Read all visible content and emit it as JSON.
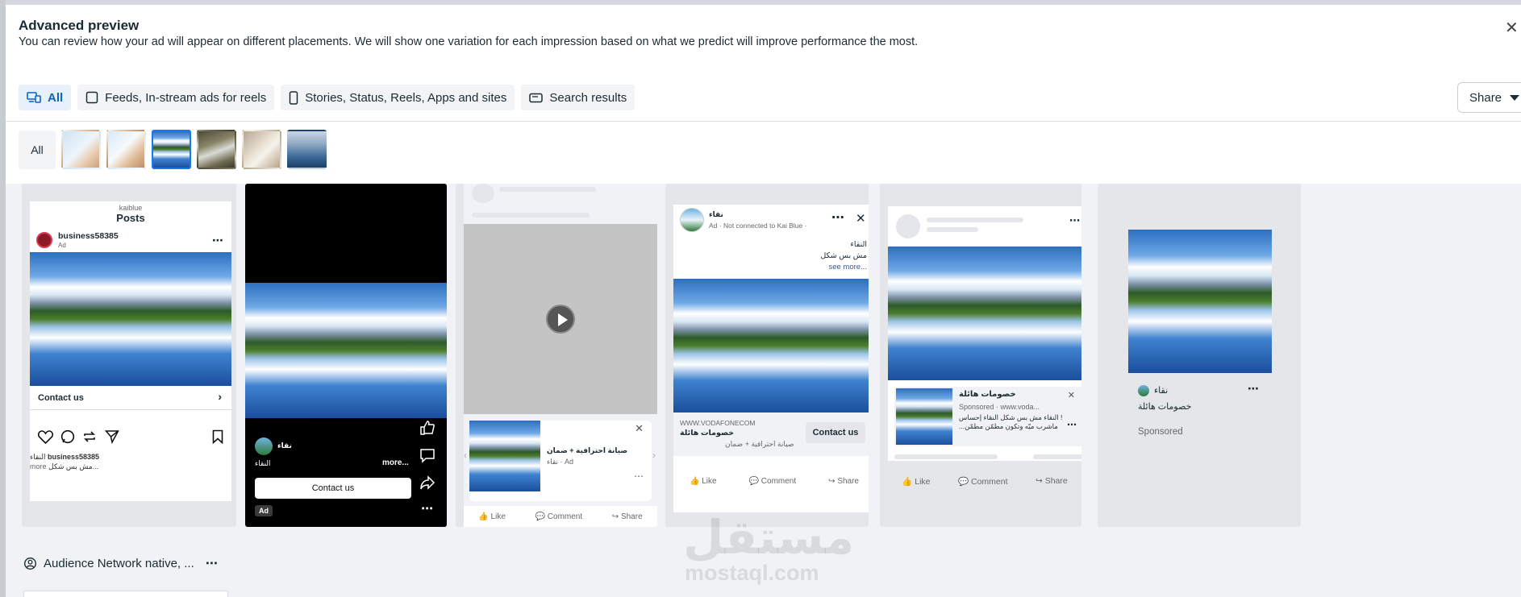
{
  "dialog": {
    "title": "Advanced preview",
    "subtitle": "You can review how your ad will appear on different placements. We will show one variation for each impression based on what we predict will improve performance the most.",
    "close_icon": "close-icon"
  },
  "tabs": [
    {
      "label": "All",
      "icon": "devices-icon",
      "active": true
    },
    {
      "label": "Feeds, In-stream ads for reels",
      "icon": "square-icon",
      "active": false
    },
    {
      "label": "Stories, Status, Reels, Apps and sites",
      "icon": "phone-icon",
      "active": false
    },
    {
      "label": "Search results",
      "icon": "search-box-icon",
      "active": false
    }
  ],
  "share": {
    "label": "Share"
  },
  "thumbnails": {
    "all_label": "All"
  },
  "instagram": {
    "account": "kaiblue",
    "header": "Posts",
    "username": "business58385",
    "ad_label": "Ad",
    "cta": "Contact us",
    "caption_user": "business58385",
    "caption_text": "النقاء",
    "caption_line2": "مش بس شكل...",
    "more": "more"
  },
  "reels": {
    "page": "نقاء",
    "caption": "النقاء",
    "more": "more...",
    "cta": "Contact us",
    "ad_badge": "Ad"
  },
  "video_feed": {
    "headline": "صيانة احترافية + ضمان",
    "sub": "نقاء · Ad",
    "like": "Like",
    "comment": "Comment",
    "share": "Share"
  },
  "fb_feed": {
    "page": "نقاء",
    "meta": "Ad · Not connected to Kai Blue ·",
    "text1": "النقاء",
    "text2": "مش بس شكل",
    "see_more": "see more...",
    "url": "WWW.VODAFONECOM",
    "headline": "خصومات هائلة",
    "description": "صيانة احترافية + ضمان",
    "cta": "Contact us",
    "like": "Like",
    "comment": "Comment",
    "share": "Share"
  },
  "right_col": {
    "headline": "خصومات هائلة",
    "sponsored": "Sponsored · www.voda...",
    "desc1": "النقاء مش بس شكل النقاء إحساس !",
    "desc2": "...ماشرب ميّه وتكون مطمّن مطمّن",
    "like": "Like",
    "comment": "Comment",
    "share": "Share"
  },
  "marketplace": {
    "page": "نقاء",
    "headline": "خصومات هائلة",
    "sponsored": "Sponsored"
  },
  "audience_network": {
    "label": "Audience Network native, ..."
  },
  "watermark": {
    "arabic": "مستقل",
    "latin": "mostaql.com"
  },
  "colors": {
    "accent": "#1877f2",
    "tab_active": "#0a66c2"
  }
}
